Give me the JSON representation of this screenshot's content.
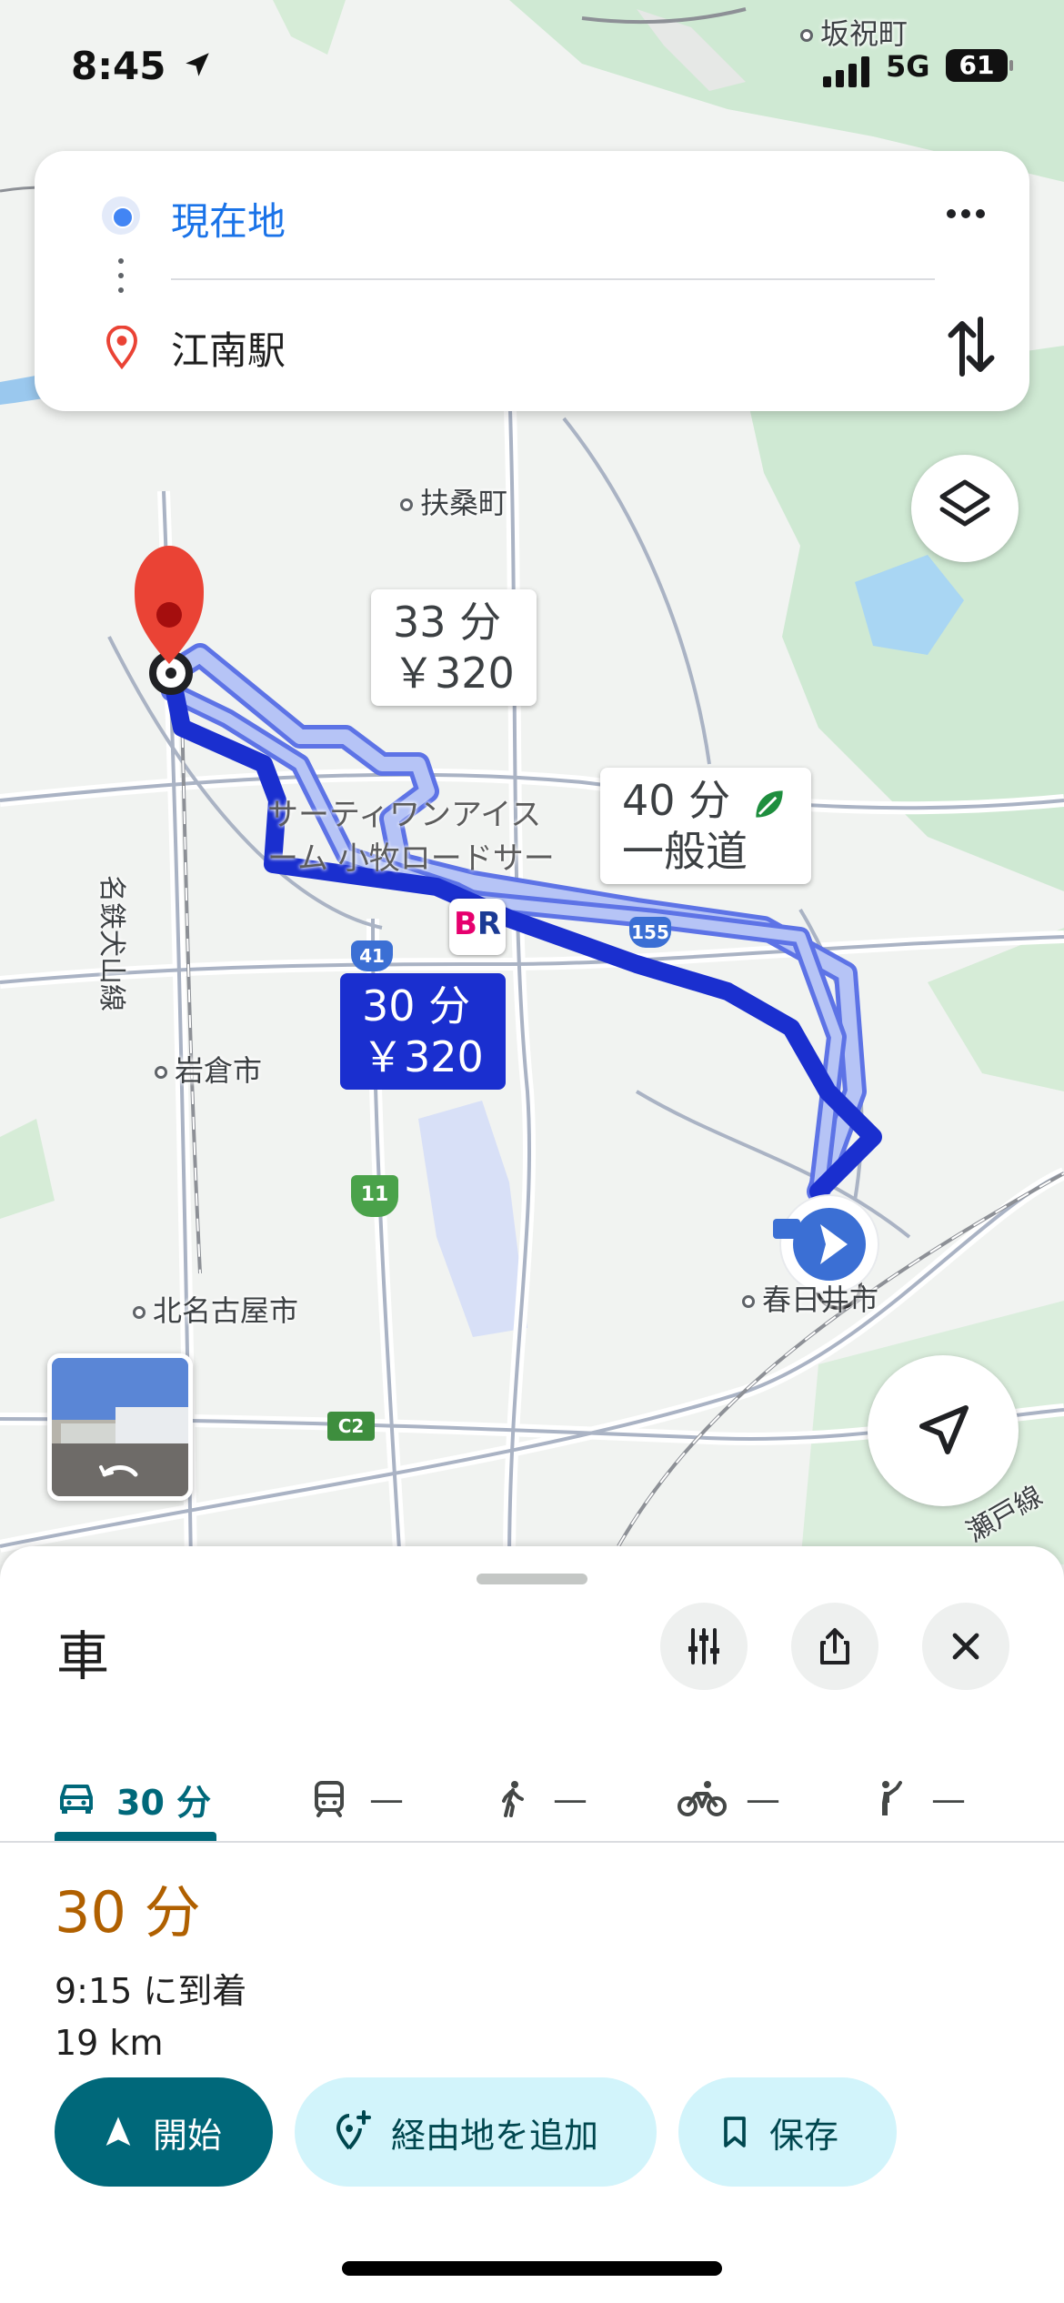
{
  "status_bar": {
    "time": "8:45",
    "network": "5G",
    "battery": "61"
  },
  "search": {
    "origin": "現在地",
    "destination": "江南駅"
  },
  "map": {
    "place_labels": {
      "sakaiwaicho": "坂祝町",
      "fusocho": "扶桑町",
      "iwakurashi": "岩倉市",
      "kitanagoyashi": "北名古屋市",
      "kasugaishi": "春日井市",
      "meitetsu_line": "名鉄犬山線",
      "seto_line": "瀬戸線"
    },
    "poi": {
      "name_line1": "サーティワンアイス",
      "name_line2": "ーム 小牧ロードサー"
    },
    "road_shields": {
      "r41": "41",
      "r155": "155",
      "r11": "11",
      "c2": "C2"
    },
    "routes": [
      {
        "time": "30 分",
        "toll": "￥320",
        "selected": true
      },
      {
        "time": "33 分",
        "toll": "￥320",
        "selected": false
      },
      {
        "time": "40 分",
        "note": "一般道",
        "selected": false
      }
    ]
  },
  "sheet": {
    "mode_title": "車",
    "tabs": [
      {
        "label": "30 分",
        "icon": "car-icon"
      },
      {
        "label": "—",
        "icon": "transit-icon"
      },
      {
        "label": "—",
        "icon": "walk-icon"
      },
      {
        "label": "—",
        "icon": "bike-icon"
      },
      {
        "label": "—",
        "icon": "ride-icon"
      }
    ],
    "duration": "30 分",
    "arrival": "9:15 に到着",
    "distance": "19 km",
    "buttons": {
      "start": "開始",
      "add_stop": "経由地を追加",
      "save": "保存"
    }
  },
  "colors": {
    "route_primary": "#1a2fcf",
    "route_alt": "#8fa3f0",
    "accent": "#00687a",
    "duration": "#b06000"
  }
}
